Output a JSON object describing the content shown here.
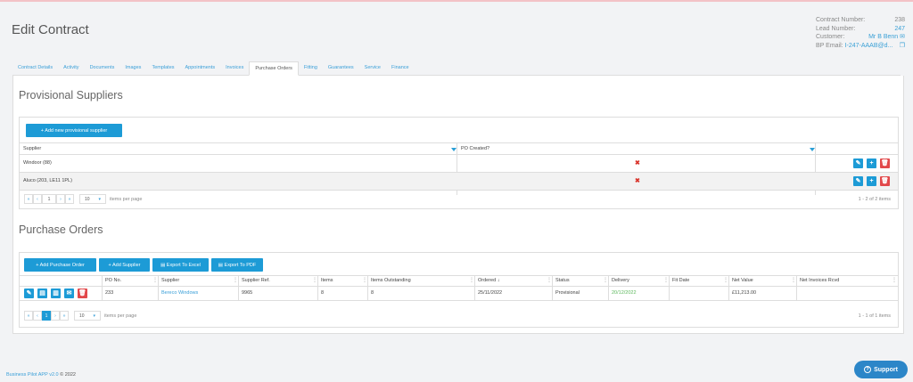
{
  "page": {
    "title": "Edit Contract"
  },
  "contract_info": {
    "contract_number_label": "Contract Number:",
    "contract_number": "238",
    "lead_number_label": "Lead Number:",
    "lead_number": "247",
    "customer_label": "Customer:",
    "customer": "Mr B Benn",
    "bp_email_label": "BP Email:",
    "bp_email": "I-247-AAAB@d..."
  },
  "tabs": [
    "Contract Details",
    "Activity",
    "Documents",
    "Images",
    "Templates",
    "Appointments",
    "Invoices",
    "Purchase Orders",
    "Fitting",
    "Guarantees",
    "Service",
    "Finance"
  ],
  "active_tab": "Purchase Orders",
  "provisional": {
    "title": "Provisional Suppliers",
    "add_button": "+ Add new provisional supplier",
    "columns": [
      "Supplier",
      "PO Created?"
    ],
    "rows": [
      {
        "supplier": "Windoor (88)",
        "po_created": "✖"
      },
      {
        "supplier": "Aluco (203, LE11 1PL)",
        "po_created": "✖"
      }
    ],
    "pager": {
      "first": "«",
      "prev": "‹",
      "page": "1",
      "next": "›",
      "last": "»",
      "per_page": "10",
      "per_page_label": "items per page",
      "count": "1 - 2 of 2 items"
    }
  },
  "purchase_orders": {
    "title": "Purchase Orders",
    "buttons": {
      "add_po": "+ Add Purchase Order",
      "add_supplier": "+ Add Supplier",
      "export_excel": "Export To Excel",
      "export_pdf": "Export To PDF"
    },
    "columns": [
      "PO No.",
      "Supplier",
      "Supplier Ref.",
      "Items",
      "Items Outstanding",
      "Ordered",
      "Status",
      "Delivery",
      "Fit Date",
      "Net Value",
      "Net Invoices Rcvd"
    ],
    "sort_indicator": "↓",
    "rows": [
      {
        "po_no": "233",
        "supplier": "Bereco Windows",
        "supplier_ref": "9965",
        "items": "8",
        "items_outstanding": "8",
        "ordered": "25/11/2022",
        "status": "Provisional",
        "delivery": "20/12/2022",
        "fit_date": "",
        "net_value": "£11,213.00",
        "net_invoices": ""
      }
    ],
    "pager": {
      "first": "«",
      "prev": "‹",
      "page": "1",
      "next": "›",
      "last": "»",
      "per_page": "10",
      "per_page_label": "items per page",
      "count": "1 - 1 of 1 items"
    }
  },
  "footer": {
    "app_name": "Business Pilot APP v2.0",
    "copyright": "© 2022"
  },
  "support": {
    "label": "Support"
  },
  "colors": {
    "accent": "#1d9bd6",
    "danger": "#e2484a",
    "delivery_green": "#5cb85c"
  }
}
